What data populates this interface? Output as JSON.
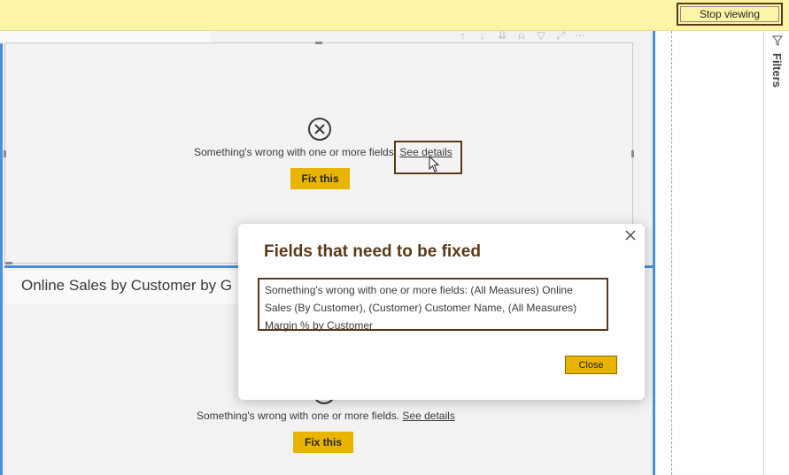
{
  "topbar": {
    "stop_viewing": "Stop viewing"
  },
  "filters": {
    "label": "Filters",
    "icon": "filter-icon"
  },
  "visual1": {
    "error_text": "Something's wrong with one or more fields.",
    "details_link": "See details",
    "fix_label": "Fix this",
    "icon": "error-circle-x-icon"
  },
  "visual2": {
    "title": "Online Sales by Customer by G",
    "error_text": "Something's wrong with one or more fields.",
    "details_link": "See details",
    "fix_label": "Fix this"
  },
  "dialog": {
    "title": "Fields that need to be fixed",
    "message": "Something's wrong with one or more fields: (All Measures) Online Sales (By Customer), (Customer) Customer Name, (All Measures) Margin % by Customer",
    "close_label": "Close"
  },
  "colors": {
    "accent_yellow": "#e8b400",
    "banner": "#fdf4a6",
    "focus_blue": "#4a90d9",
    "highlight_brown": "#5a3a16"
  }
}
